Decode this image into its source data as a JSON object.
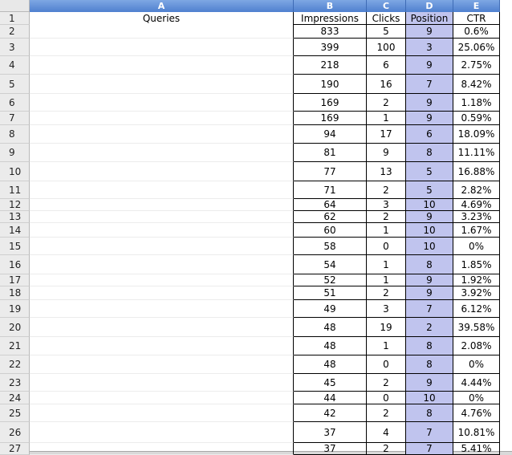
{
  "columns": [
    {
      "letter": "A",
      "header": "Queries"
    },
    {
      "letter": "B",
      "header": "Impressions"
    },
    {
      "letter": "C",
      "header": "Clicks"
    },
    {
      "letter": "D",
      "header": "Position"
    },
    {
      "letter": "E",
      "header": "CTR"
    }
  ],
  "rows": [
    {
      "row": "2",
      "impressions": "833",
      "clicks": "5",
      "position": "9",
      "ctr": "0.6%"
    },
    {
      "row": "3",
      "impressions": "399",
      "clicks": "100",
      "position": "3",
      "ctr": "25.06%"
    },
    {
      "row": "4",
      "impressions": "218",
      "clicks": "6",
      "position": "9",
      "ctr": "2.75%"
    },
    {
      "row": "5",
      "impressions": "190",
      "clicks": "16",
      "position": "7",
      "ctr": "8.42%"
    },
    {
      "row": "6",
      "impressions": "169",
      "clicks": "2",
      "position": "9",
      "ctr": "1.18%"
    },
    {
      "row": "7",
      "impressions": "169",
      "clicks": "1",
      "position": "9",
      "ctr": "0.59%"
    },
    {
      "row": "8",
      "impressions": "94",
      "clicks": "17",
      "position": "6",
      "ctr": "18.09%"
    },
    {
      "row": "9",
      "impressions": "81",
      "clicks": "9",
      "position": "8",
      "ctr": "11.11%"
    },
    {
      "row": "10",
      "impressions": "77",
      "clicks": "13",
      "position": "5",
      "ctr": "16.88%"
    },
    {
      "row": "11",
      "impressions": "71",
      "clicks": "2",
      "position": "5",
      "ctr": "2.82%"
    },
    {
      "row": "12",
      "impressions": "64",
      "clicks": "3",
      "position": "10",
      "ctr": "4.69%"
    },
    {
      "row": "13",
      "impressions": "62",
      "clicks": "2",
      "position": "9",
      "ctr": "3.23%"
    },
    {
      "row": "14",
      "impressions": "60",
      "clicks": "1",
      "position": "10",
      "ctr": "1.67%"
    },
    {
      "row": "15",
      "impressions": "58",
      "clicks": "0",
      "position": "10",
      "ctr": "0%"
    },
    {
      "row": "16",
      "impressions": "54",
      "clicks": "1",
      "position": "8",
      "ctr": "1.85%"
    },
    {
      "row": "17",
      "impressions": "52",
      "clicks": "1",
      "position": "9",
      "ctr": "1.92%"
    },
    {
      "row": "18",
      "impressions": "51",
      "clicks": "2",
      "position": "9",
      "ctr": "3.92%"
    },
    {
      "row": "19",
      "impressions": "49",
      "clicks": "3",
      "position": "7",
      "ctr": "6.12%"
    },
    {
      "row": "20",
      "impressions": "48",
      "clicks": "19",
      "position": "2",
      "ctr": "39.58%"
    },
    {
      "row": "21",
      "impressions": "48",
      "clicks": "1",
      "position": "8",
      "ctr": "2.08%"
    },
    {
      "row": "22",
      "impressions": "48",
      "clicks": "0",
      "position": "8",
      "ctr": "0%"
    },
    {
      "row": "23",
      "impressions": "45",
      "clicks": "2",
      "position": "9",
      "ctr": "4.44%"
    },
    {
      "row": "24",
      "impressions": "44",
      "clicks": "0",
      "position": "10",
      "ctr": "0%"
    },
    {
      "row": "25",
      "impressions": "42",
      "clicks": "2",
      "position": "8",
      "ctr": "4.76%"
    },
    {
      "row": "26",
      "impressions": "37",
      "clicks": "4",
      "position": "7",
      "ctr": "10.81%"
    },
    {
      "row": "27",
      "impressions": "37",
      "clicks": "2",
      "position": "7",
      "ctr": "5.41%"
    }
  ],
  "colors": {
    "column_header": "#5b8bd6",
    "position_fill": "#c0c4ee",
    "row_header": "#ebebeb"
  }
}
